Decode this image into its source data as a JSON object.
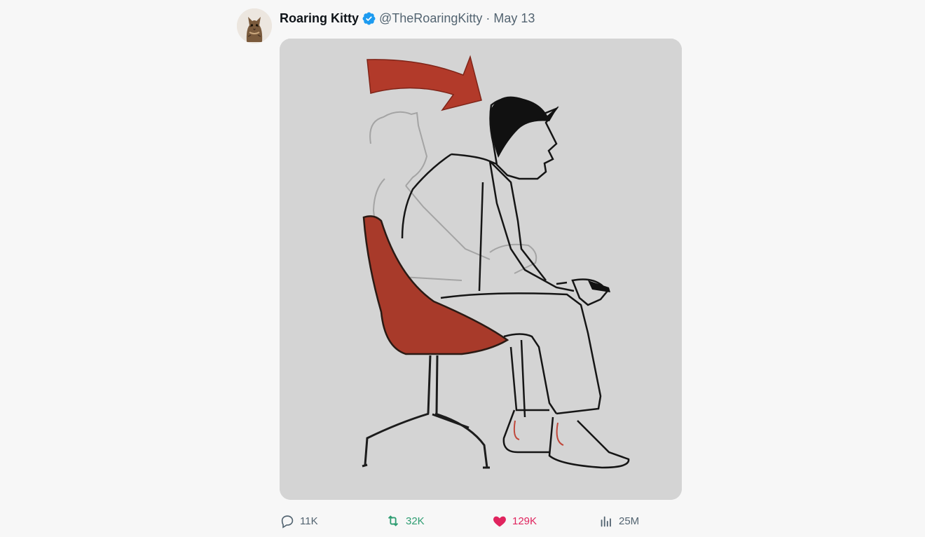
{
  "tweet": {
    "author_name": "Roaring Kitty",
    "handle": "@TheRoaringKitty",
    "separator": "·",
    "date": "May 13"
  },
  "media": {
    "icon": "illustration-image"
  },
  "actions": {
    "replies": "11K",
    "retweets": "32K",
    "likes": "129K",
    "views": "25M"
  },
  "colors": {
    "verified": "#1d9bf0",
    "retweet": "#2e9d72",
    "like": "#e0245e",
    "muted": "#536471",
    "arrow_red": "#b23a2a"
  }
}
